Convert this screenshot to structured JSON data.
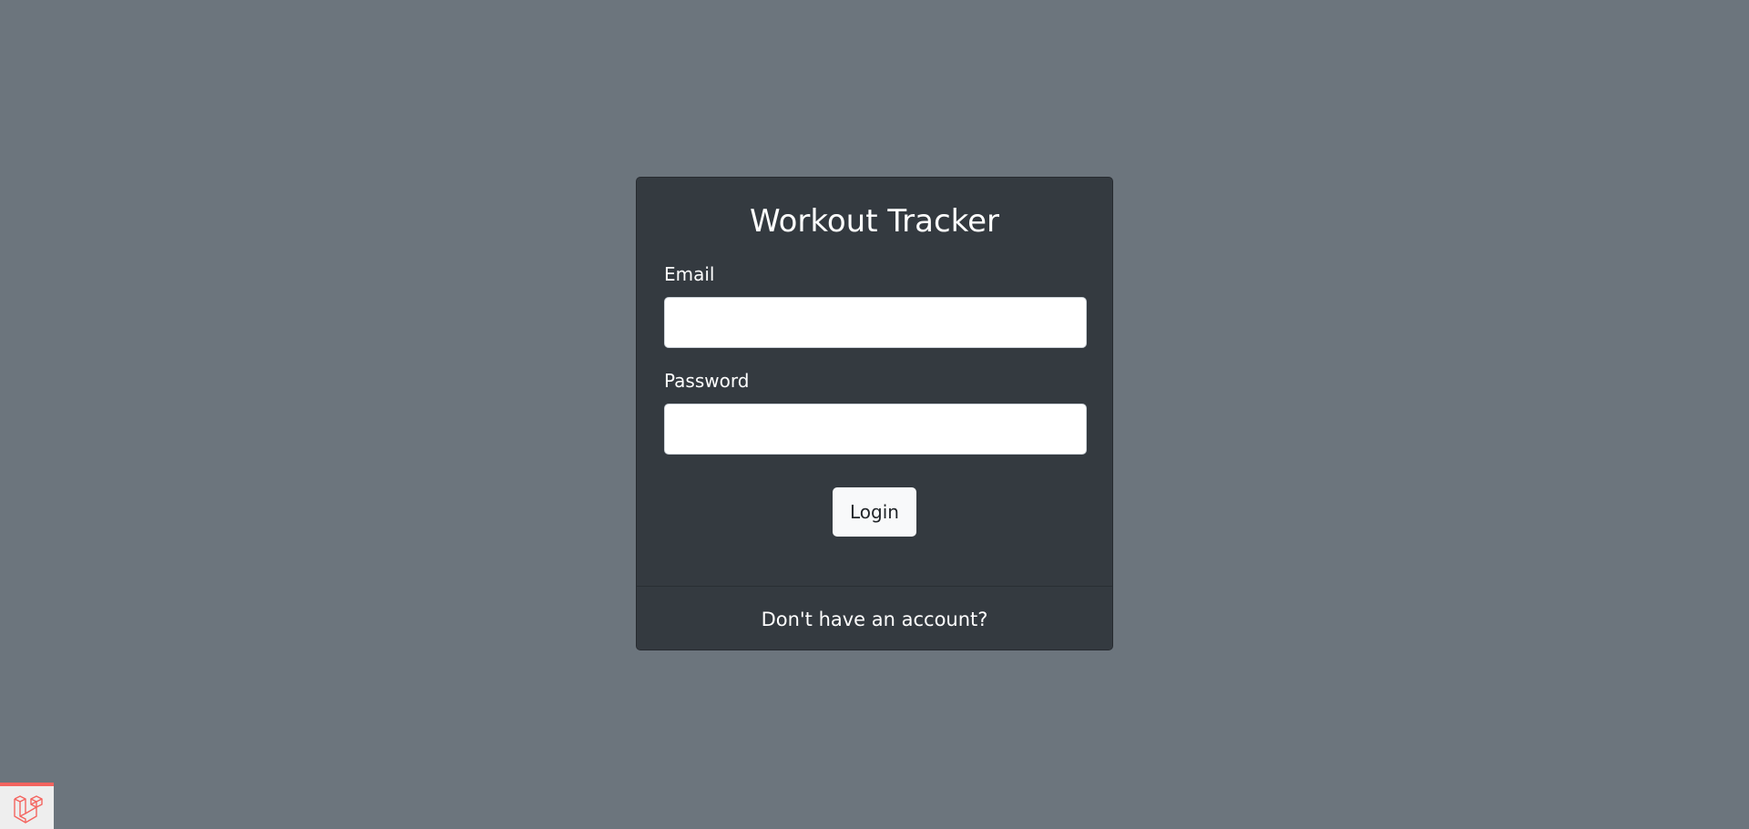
{
  "login_card": {
    "title": "Workout Tracker",
    "email_label": "Email",
    "email_value": "",
    "password_label": "Password",
    "password_value": "",
    "login_button": "Login",
    "register_link": "Don't have an account?"
  },
  "debugbar": {
    "icon": "laravel-logo-icon",
    "accent_color": "#f4645f"
  },
  "colors": {
    "page_background": "#6c757d",
    "card_background": "#343a40"
  }
}
